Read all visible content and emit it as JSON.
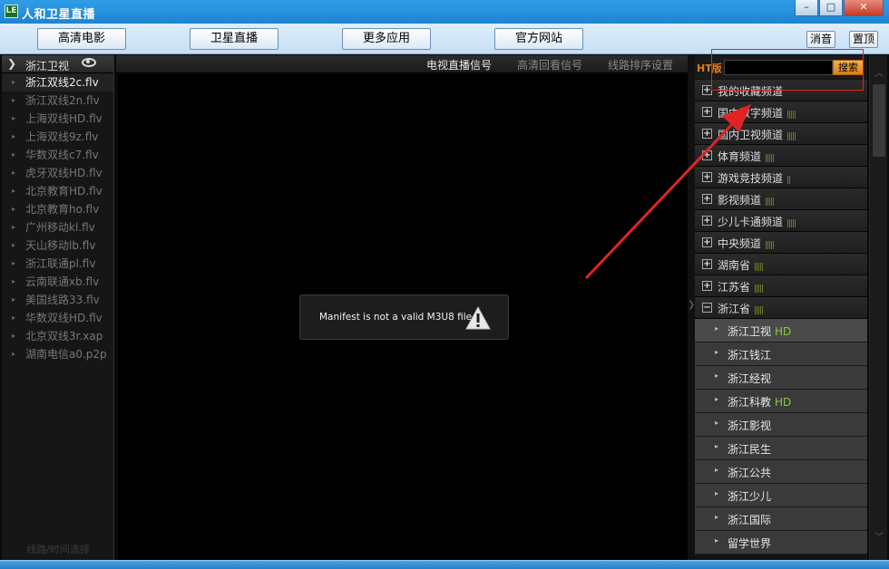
{
  "window": {
    "title": "人和卫星直播",
    "icon_text": "LE"
  },
  "toolbar": {
    "buttons": [
      "高清电影",
      "卫星直播",
      "更多应用",
      "官方网站"
    ],
    "mute_label": "消音",
    "top_label": "置顶"
  },
  "left_panel": {
    "title": "浙江卫视",
    "lines": [
      "浙江双线2c.flv",
      "浙江双线2n.flv",
      "上海双线HD.flv",
      "上海双线9z.flv",
      "华数双线c7.flv",
      "虎牙双线HD.flv",
      "北京教育HD.flv",
      "北京教育ho.flv",
      "广州移动kl.flv",
      "天山移动lb.flv",
      "浙江联通pl.flv",
      "云南联通xb.flv",
      "美国线路33.flv",
      "华数双线HD.flv",
      "北京双线3r.xap",
      "湖南电信a0.p2p"
    ],
    "active_index": 0,
    "footer": "线路/时间选择"
  },
  "player": {
    "tabs": [
      "电视直播信号",
      "高清回看信号",
      "线路排序设置"
    ],
    "active_tab": 0,
    "error_message": "Manifest is not a valid M3U8 file"
  },
  "right_panel": {
    "ht_label": "HT版",
    "search_value": "",
    "search_button": "搜索",
    "categories": [
      {
        "name": "我的收藏频道",
        "bars": "",
        "expanded": false
      },
      {
        "name": "国内数字频道",
        "bars": "|||||",
        "expanded": false
      },
      {
        "name": "国内卫视频道",
        "bars": "|||||",
        "expanded": false
      },
      {
        "name": "体育频道",
        "bars": "|||||",
        "expanded": false
      },
      {
        "name": "游戏竞技频道",
        "bars": "||",
        "expanded": false
      },
      {
        "name": "影视频道",
        "bars": "|||||",
        "expanded": false
      },
      {
        "name": "少儿卡通频道",
        "bars": "|||||",
        "expanded": false
      },
      {
        "name": "中央频道",
        "bars": "|||||",
        "expanded": false
      },
      {
        "name": "湖南省",
        "bars": "|||||",
        "expanded": false
      },
      {
        "name": "江苏省",
        "bars": "|||||",
        "expanded": false
      },
      {
        "name": "浙江省",
        "bars": "|||||",
        "expanded": true
      }
    ],
    "channels": [
      {
        "name": "浙江卫视",
        "hd": "HD",
        "selected": true
      },
      {
        "name": "浙江钱江",
        "hd": "",
        "selected": false
      },
      {
        "name": "浙江经视",
        "hd": "",
        "selected": false
      },
      {
        "name": "浙江科教",
        "hd": "HD",
        "selected": false
      },
      {
        "name": "浙江影视",
        "hd": "",
        "selected": false
      },
      {
        "name": "浙江民生",
        "hd": "",
        "selected": false
      },
      {
        "name": "浙江公共",
        "hd": "",
        "selected": false
      },
      {
        "name": "浙江少儿",
        "hd": "",
        "selected": false
      },
      {
        "name": "浙江国际",
        "hd": "",
        "selected": false
      },
      {
        "name": "留学世界",
        "hd": "",
        "selected": false
      }
    ]
  },
  "colors": {
    "accent": "#e07a1c",
    "hd": "#8cc63f",
    "annotation": "#e02424"
  },
  "icons": {
    "app": "app-logo-icon",
    "eye": "eye-icon",
    "warning": "warning-icon"
  }
}
